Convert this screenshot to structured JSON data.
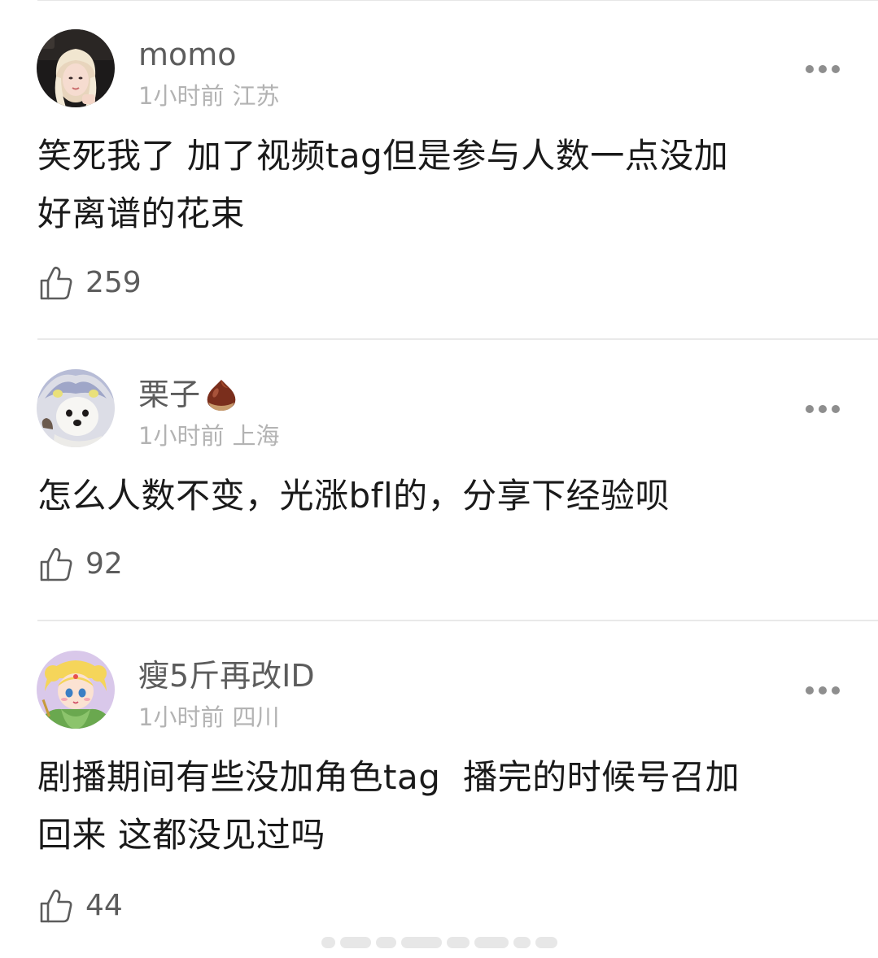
{
  "comments": [
    {
      "username": "momo",
      "time": "1小时前",
      "location": "江苏",
      "text_lines": [
        "笑死我了 加了视频tag但是参与人数一点没加",
        "好离谱的花束"
      ],
      "likes": "259",
      "avatar_icon": "avatar-blonde-girl-photo",
      "more_icon": "more-dots-icon"
    },
    {
      "username": "栗子",
      "username_emoji": "chestnut-emoji",
      "time": "1小时前",
      "location": "上海",
      "text_lines": [
        "怎么人数不变，光涨bfl的，分享下经验呗"
      ],
      "likes": "92",
      "avatar_icon": "avatar-white-puppy-photo",
      "more_icon": "more-dots-icon"
    },
    {
      "username": "瘦5斤再改ID",
      "time": "1小时前",
      "location": "四川",
      "text_lines": [
        "剧播期间有些没加角色tag  播完的时候号召加",
        "回来 这都没见过吗"
      ],
      "likes": "44",
      "avatar_icon": "avatar-sailor-moon-illustration",
      "more_icon": "more-dots-icon"
    }
  ],
  "icons": {
    "like": "thumbs-up-icon"
  },
  "colors": {
    "username": "#5c5c5c",
    "meta": "#b3b3b3",
    "text": "#1a1a1a",
    "divider": "#e9e9e9"
  }
}
